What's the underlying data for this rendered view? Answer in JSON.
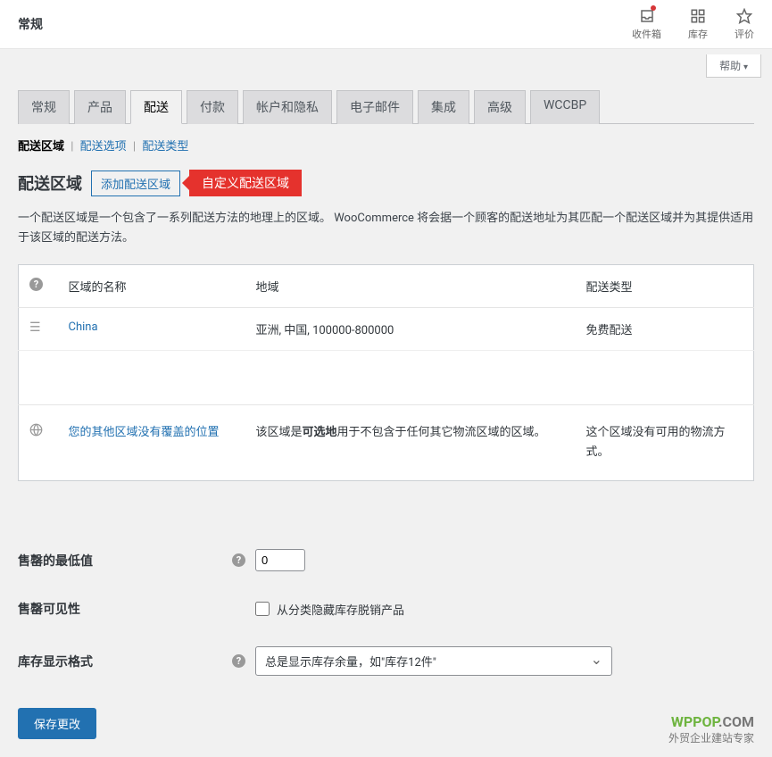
{
  "topbar": {
    "title": "常规",
    "inbox": "收件箱",
    "inventory": "库存",
    "reviews": "评价"
  },
  "help_btn": "帮助",
  "tabs": [
    "常规",
    "产品",
    "配送",
    "付款",
    "帐户和隐私",
    "电子邮件",
    "集成",
    "高级",
    "WCCBP"
  ],
  "active_tab": 2,
  "subnav": {
    "zones": "配送区域",
    "options": "配送选项",
    "classes": "配送类型"
  },
  "zone_header": {
    "title": "配送区域",
    "add_btn": "添加配送区域",
    "callout": "自定义配送区域"
  },
  "zone_desc": "一个配送区域是一个包含了一系列配送方法的地理上的区域。 WooCommerce 将会据一个顾客的配送地址为其匹配一个配送区域并为其提供适用于该区域的配送方法。",
  "table": {
    "headers": {
      "name": "区域的名称",
      "region": "地域",
      "type": "配送类型"
    },
    "rows": [
      {
        "name": "China",
        "region": "亚洲, 中国, 100000-800000",
        "type": "免费配送"
      }
    ],
    "footer": {
      "name": "您的其他区域没有覆盖的位置",
      "region_pre": "该区域是",
      "region_bold": "可选地",
      "region_post": "用于不包含于任何其它物流区域的区域。",
      "type": "这个区域没有可用的物流方式。"
    }
  },
  "form": {
    "low_stock_label": "售罄的最低值",
    "low_stock_value": "0",
    "visibility_label": "售罄可见性",
    "visibility_checkbox": "从分类隐藏库存脱销产品",
    "display_label": "库存显示格式",
    "display_value": "总是显示库存余量，如\"库存12件\"",
    "save_btn": "保存更改"
  },
  "watermark": {
    "brand1": "WPPOP",
    "brand2": ".COM",
    "sub": "外贸企业建站专家"
  }
}
